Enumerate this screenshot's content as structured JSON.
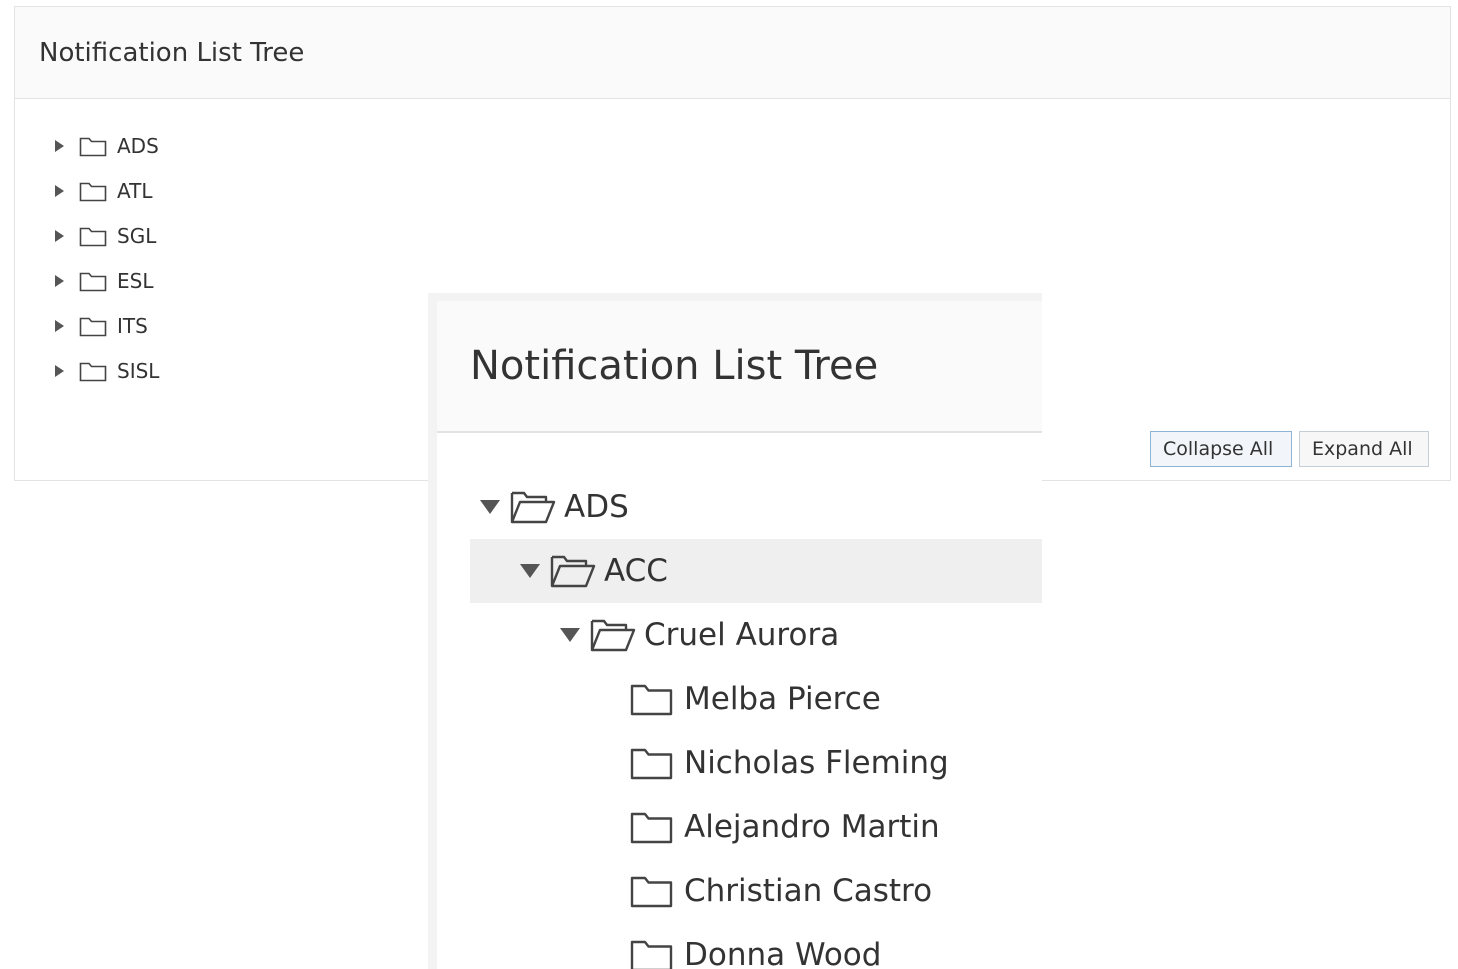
{
  "main_panel": {
    "title": "Notification List Tree",
    "tree_items": [
      {
        "label": "ADS",
        "icon": "folder-closed-icon"
      },
      {
        "label": "ATL",
        "icon": "folder-closed-icon"
      },
      {
        "label": "SGL",
        "icon": "folder-closed-icon"
      },
      {
        "label": "ESL",
        "icon": "folder-closed-icon"
      },
      {
        "label": "ITS",
        "icon": "folder-closed-icon"
      },
      {
        "label": "SISL",
        "icon": "folder-closed-icon"
      }
    ],
    "buttons": {
      "collapse_all": "Collapse All",
      "expand_all": "Expand All"
    }
  },
  "zoom_panel": {
    "title": "Notification List Tree",
    "tree_items": [
      {
        "label": "ADS",
        "icon": "folder-open-icon",
        "expanded": true
      },
      {
        "label": "ACC",
        "icon": "folder-open-icon",
        "expanded": true,
        "selected": true
      },
      {
        "label": "Cruel Aurora",
        "icon": "folder-open-icon",
        "expanded": true
      },
      {
        "label": "Melba Pierce",
        "icon": "folder-closed-icon"
      },
      {
        "label": "Nicholas Fleming",
        "icon": "folder-closed-icon"
      },
      {
        "label": "Alejandro Martin",
        "icon": "folder-closed-icon"
      },
      {
        "label": "Christian Castro",
        "icon": "folder-closed-icon"
      },
      {
        "label": "Donna Wood",
        "icon": "folder-closed-icon"
      }
    ]
  },
  "colors": {
    "header_bg": "#fafafa",
    "border": "#e3e3e3",
    "selected_row": "#efefef",
    "text": "#333333"
  }
}
